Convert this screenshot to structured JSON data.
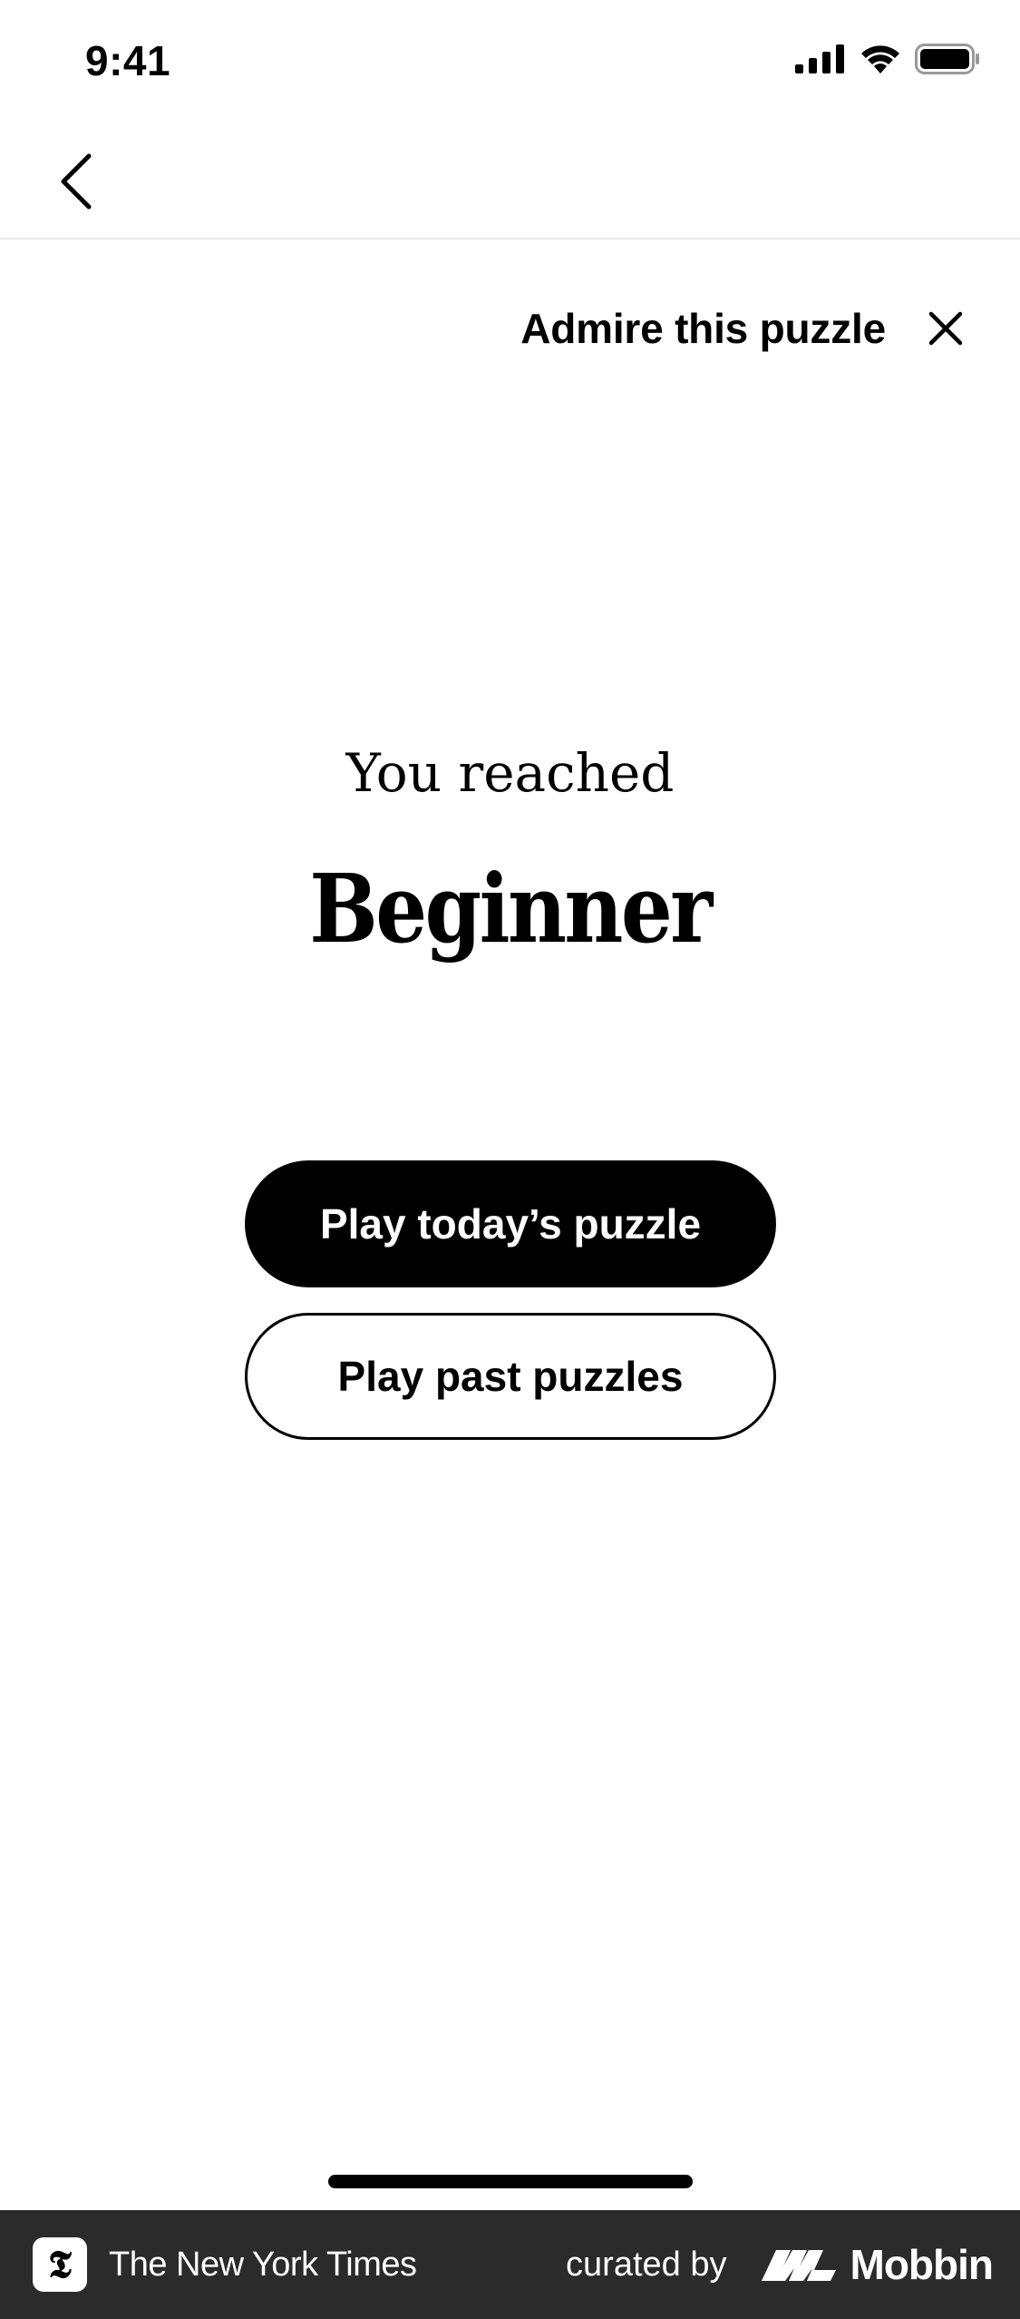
{
  "status_bar": {
    "time": "9:41"
  },
  "header": {
    "admire_label": "Admire this puzzle"
  },
  "result": {
    "reached_label": "You reached",
    "level": "Beginner"
  },
  "actions": {
    "primary_label": "Play today’s puzzle",
    "secondary_label": "Play past puzzles"
  },
  "footer": {
    "brand": "The New York Times",
    "curated_label": "curated by",
    "curator": "Mobbin"
  },
  "icons": {
    "back": "chevron-left-icon",
    "close": "close-icon",
    "signal": "signal-icon",
    "wifi": "wifi-icon",
    "battery": "battery-icon"
  },
  "colors": {
    "primary_button_bg": "#000000",
    "footer_bg": "#2b2b2b"
  }
}
